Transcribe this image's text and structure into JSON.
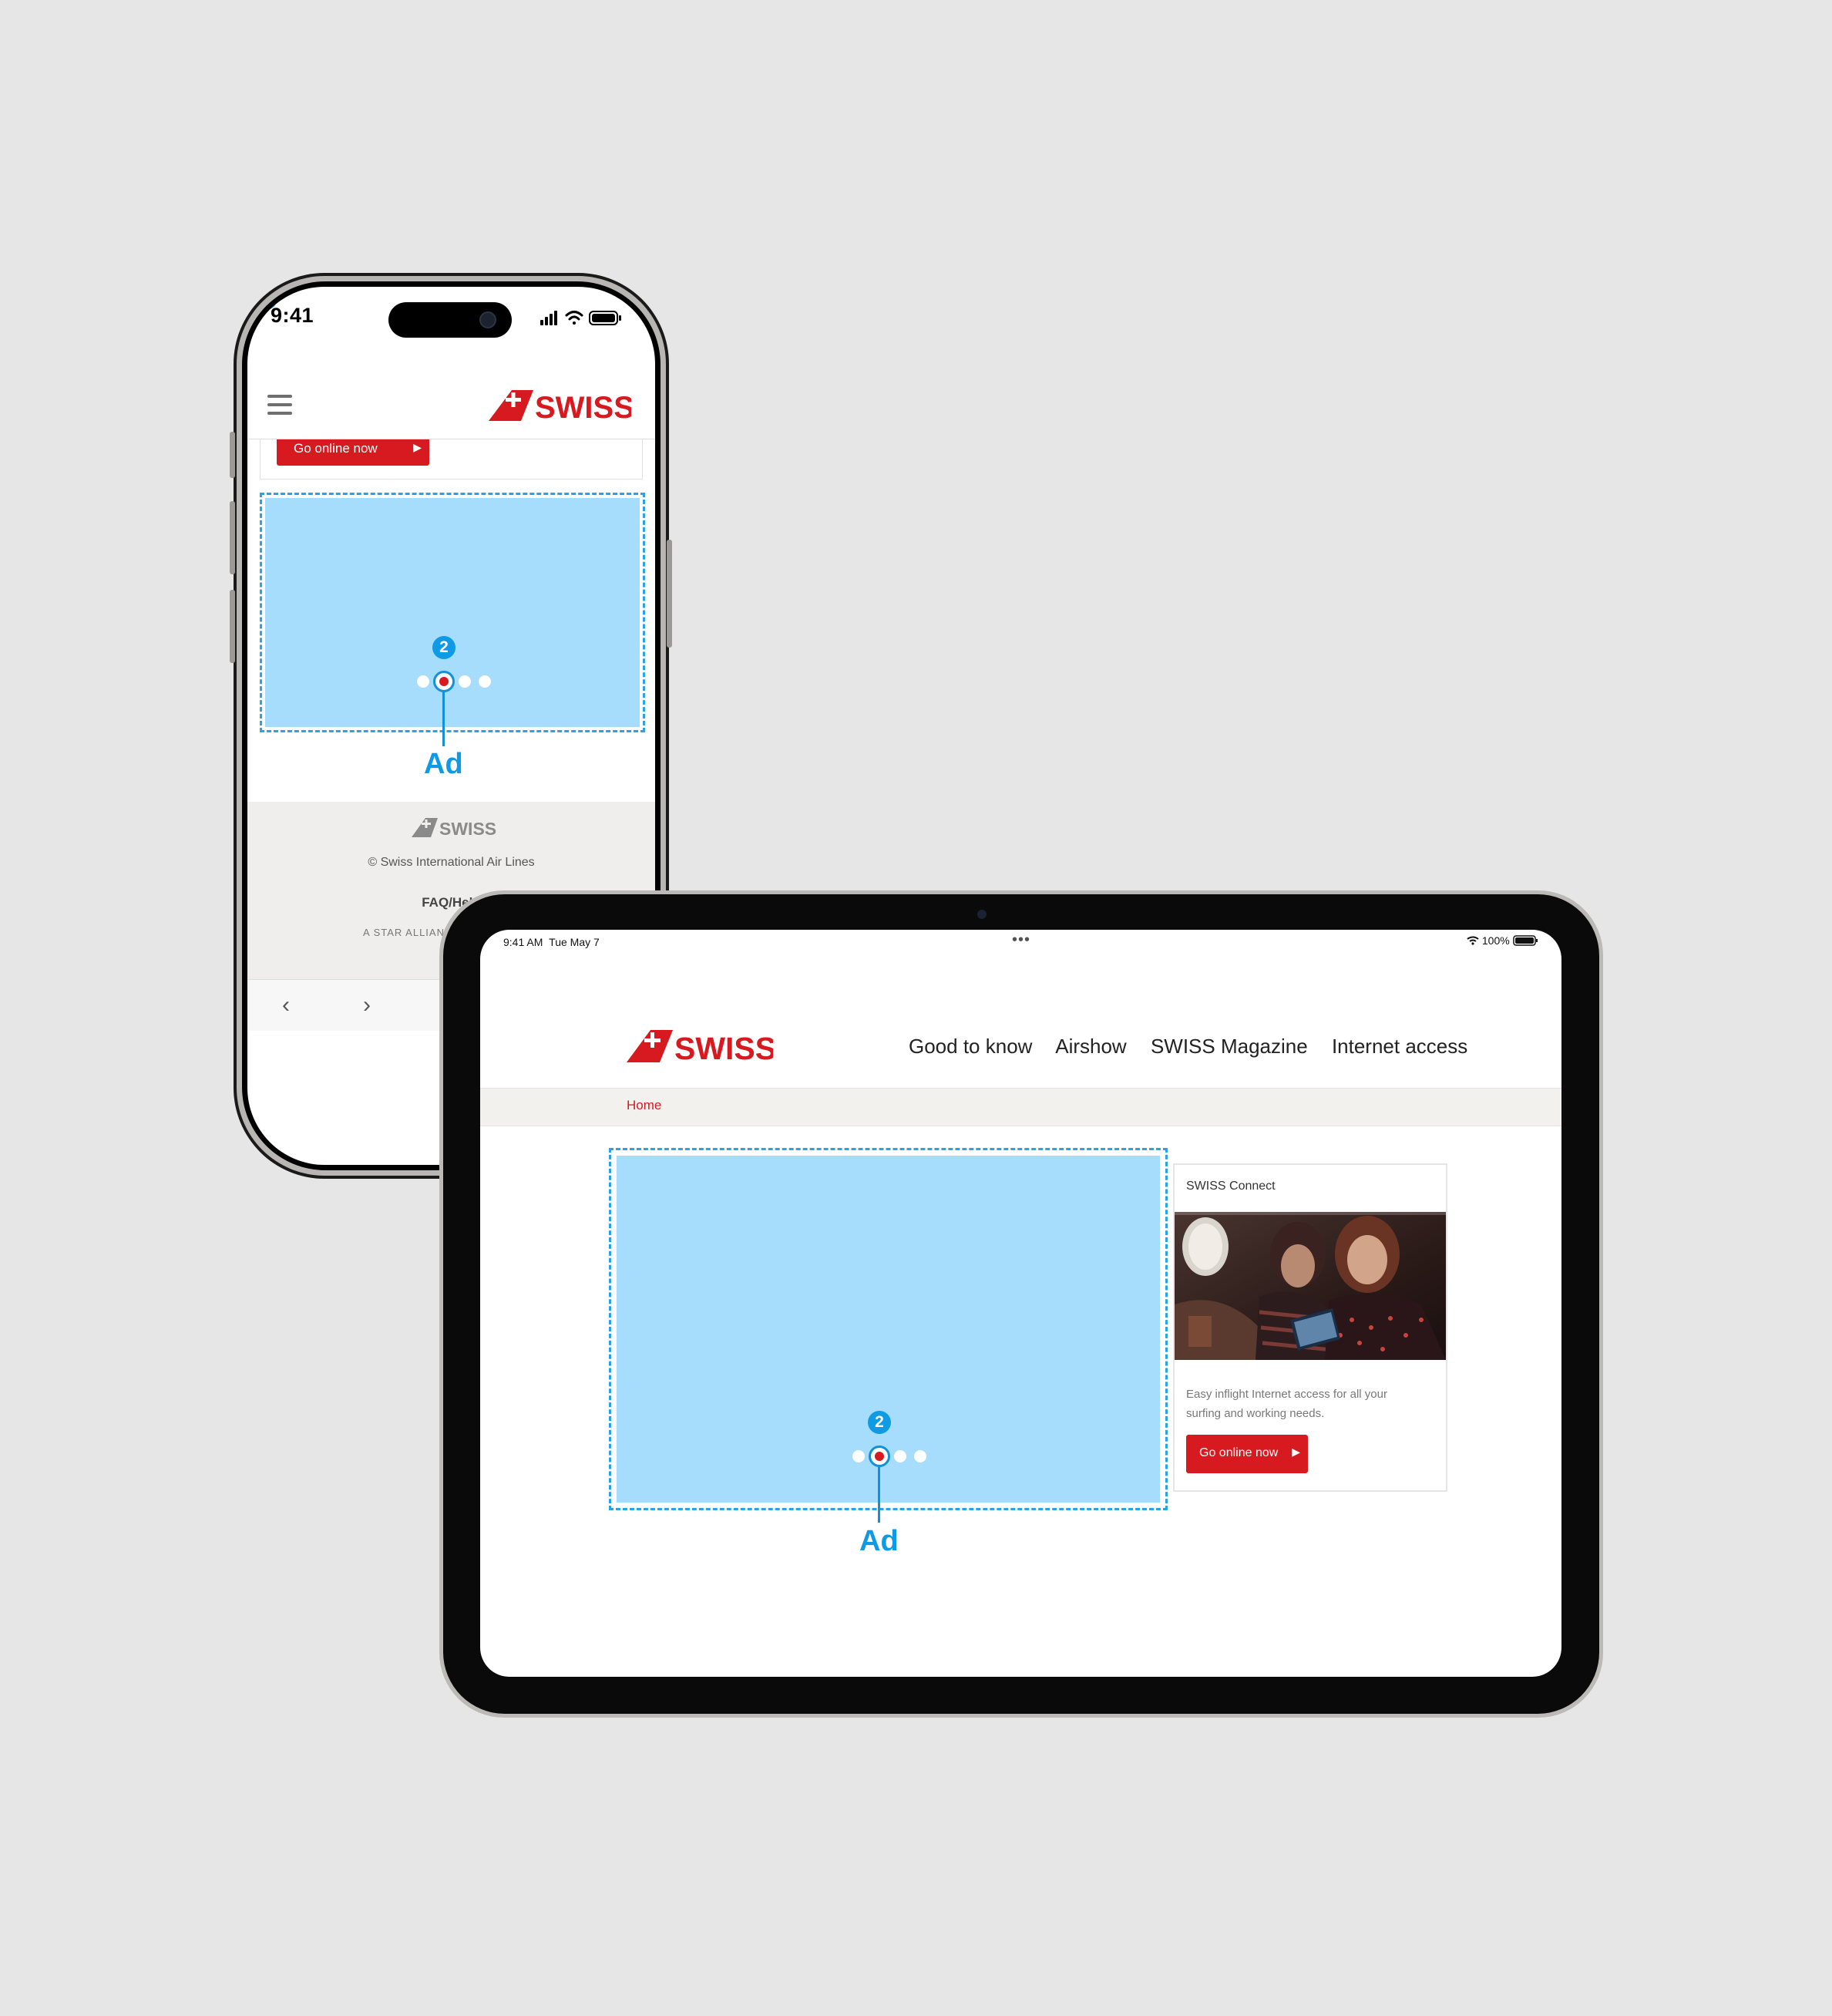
{
  "phone": {
    "status_time": "9:41",
    "brand": "SWISS",
    "cta_label": "Go online now",
    "ad_badge": "2",
    "ad_label": "Ad",
    "footer": {
      "brand": "SWISS",
      "copyright": "© Swiss International Air Lines",
      "faq": "FAQ/Help",
      "alliance": "A STAR ALLIAN"
    },
    "nav": {
      "back": "‹",
      "forward": "›"
    }
  },
  "tablet": {
    "status_time": "9:41 AM",
    "status_date": "Tue May 7",
    "battery": "100%",
    "brand": "SWISS",
    "nav_items": [
      "Good to know",
      "Airshow",
      "SWISS Magazine",
      "Internet access"
    ],
    "breadcrumb": "Home",
    "card": {
      "title": "SWISS Connect",
      "text": "Easy inflight Internet access for all your surfing and working needs.",
      "cta_label": "Go online now"
    },
    "ad_badge": "2",
    "ad_label": "Ad"
  },
  "colors": {
    "brand_red": "#d71920",
    "ad_fill": "#a6dcfc",
    "annotation_blue": "#0f9ae6",
    "background": "#e6e6e6"
  },
  "icons": [
    "hamburger-menu-icon",
    "swiss-logo",
    "signal-icon",
    "wifi-icon",
    "battery-icon",
    "chevron-right-icon",
    "back-arrow-icon",
    "forward-arrow-icon"
  ]
}
